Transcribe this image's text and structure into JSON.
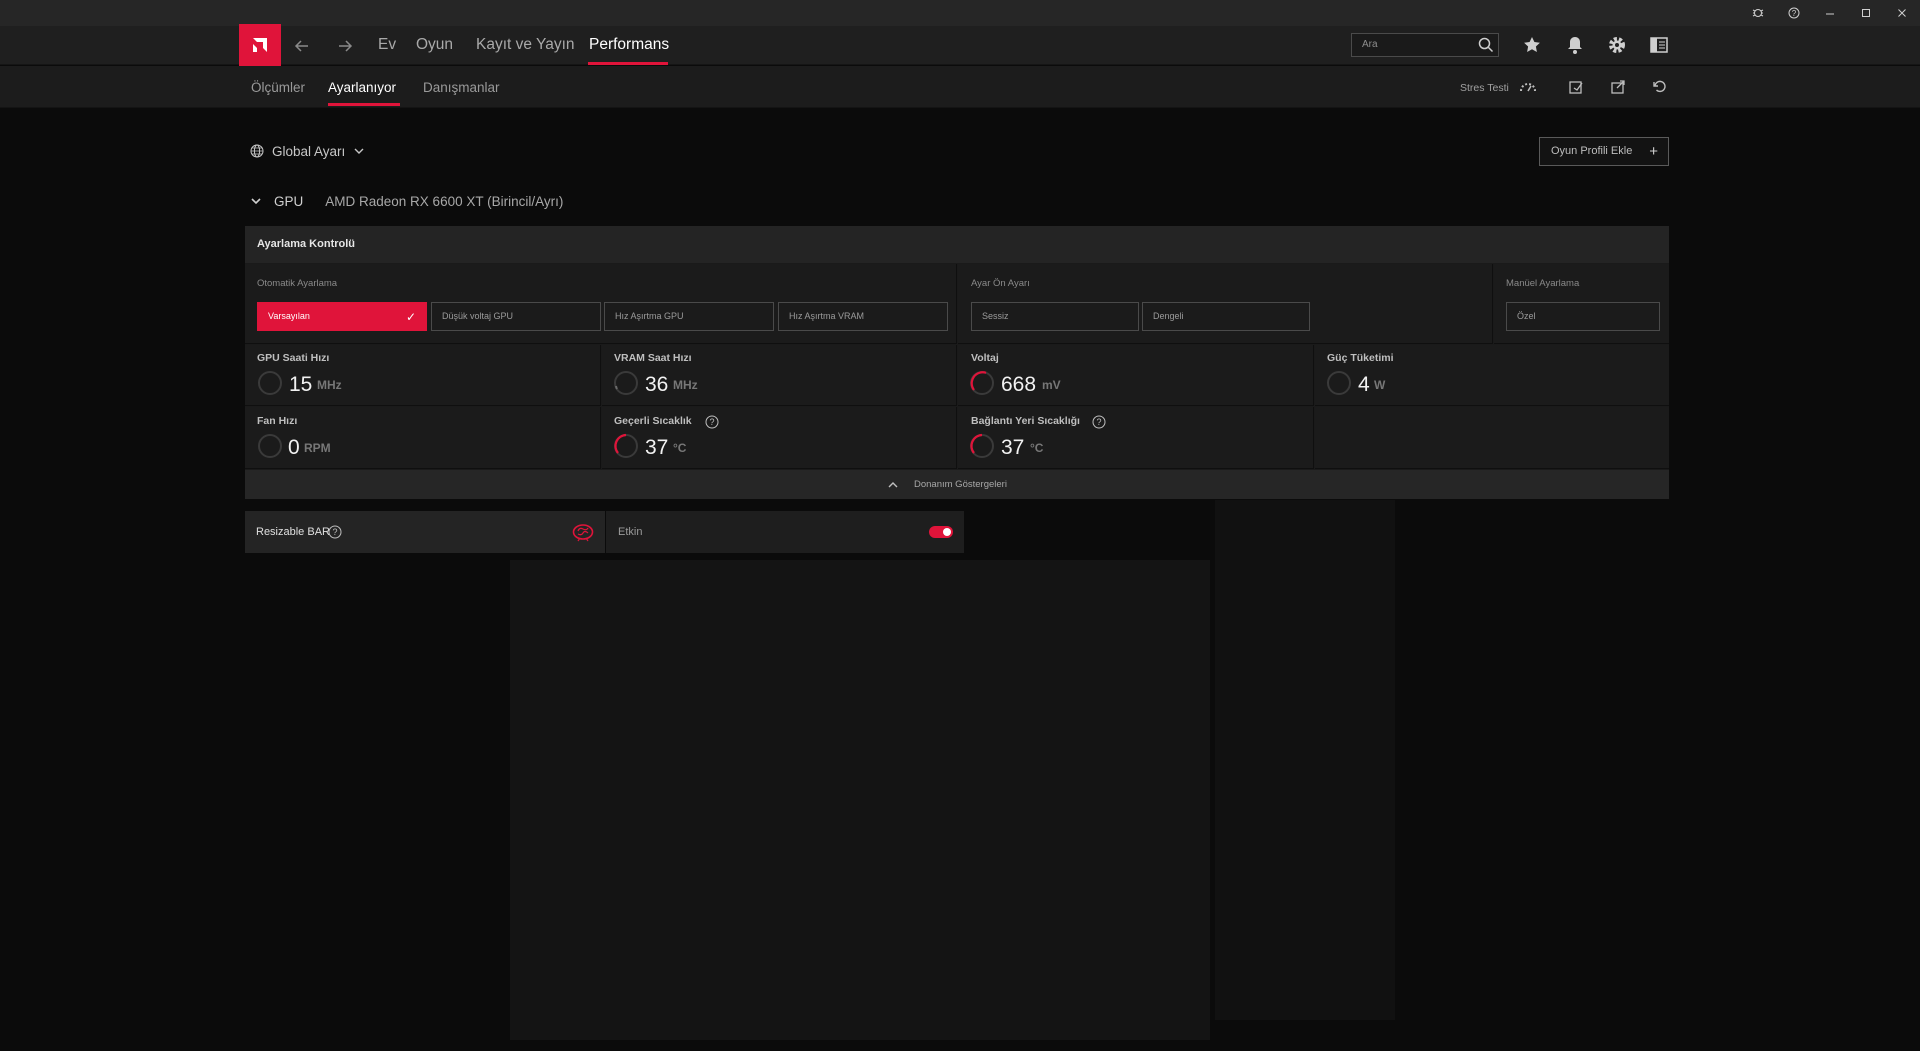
{
  "window": {
    "controls": [
      "bug-icon",
      "help-icon",
      "minimize-icon",
      "maximize-icon",
      "close-icon"
    ]
  },
  "nav": {
    "items": [
      {
        "label": "Ev",
        "active": false
      },
      {
        "label": "Oyun",
        "active": false
      },
      {
        "label": "Kayıt ve Yayın",
        "active": false
      },
      {
        "label": "Performans",
        "active": true
      }
    ],
    "search_placeholder": "Ara"
  },
  "subnav": {
    "items": [
      {
        "label": "Ölçümler",
        "active": false
      },
      {
        "label": "Ayarlanıyor",
        "active": true
      },
      {
        "label": "Danışmanlar",
        "active": false
      }
    ],
    "stress_test": "Stres Testi"
  },
  "profile": {
    "scope": "Global Ayarı",
    "add_profile": "Oyun Profili Ekle"
  },
  "gpu": {
    "label": "GPU",
    "name": "AMD Radeon RX 6600 XT (Birincil/Ayrı)"
  },
  "tuning": {
    "title": "Ayarlama Kontrolü",
    "auto": {
      "label": "Otomatik Ayarlama",
      "options": [
        "Varsayılan",
        "Düşük voltaj GPU",
        "Hız Aşırtma GPU",
        "Hız Aşırtma VRAM"
      ],
      "selected": "Varsayılan"
    },
    "preset": {
      "label": "Ayar Ön Ayarı",
      "options": [
        "Sessiz",
        "Dengeli"
      ]
    },
    "manual": {
      "label": "Manüel Ayarlama",
      "options": [
        "Özel"
      ]
    }
  },
  "metrics": {
    "gpu_clock": {
      "label": "GPU Saati Hızı",
      "value": "15",
      "unit": "MHz"
    },
    "vram_clock": {
      "label": "VRAM Saat Hızı",
      "value": "36",
      "unit": "MHz"
    },
    "voltage": {
      "label": "Voltaj",
      "value": "668",
      "unit": "mV"
    },
    "power": {
      "label": "Güç Tüketimi",
      "value": "4",
      "unit": "W"
    },
    "fan": {
      "label": "Fan Hızı",
      "value": "0",
      "unit": "RPM"
    },
    "temp": {
      "label": "Geçerli Sıcaklık",
      "value": "37",
      "unit": "°C"
    },
    "junction": {
      "label": "Bağlantı Yeri Sıcaklığı",
      "value": "37",
      "unit": "°C"
    }
  },
  "hardware_bar": {
    "label": "Donanım Göstergeleri"
  },
  "resizable_bar": {
    "label": "Resizable BAR",
    "state_label": "Etkin",
    "enabled": true
  },
  "colors": {
    "accent": "#e0143a",
    "background": "#0b0b0b",
    "panel": "#1b1b1b"
  }
}
